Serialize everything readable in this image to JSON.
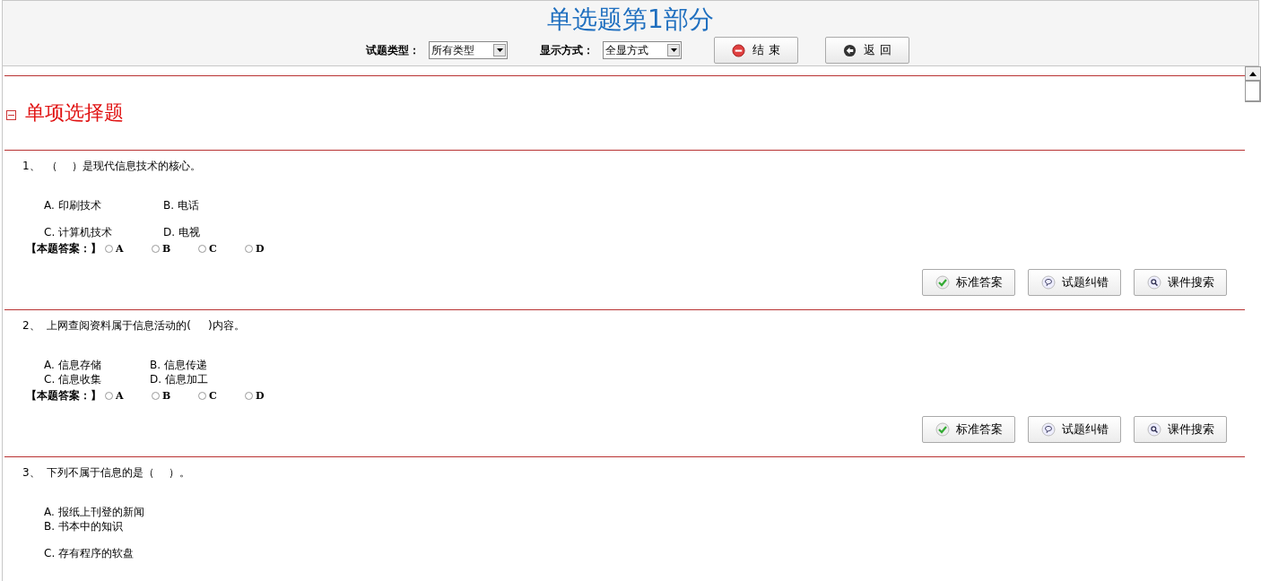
{
  "header": {
    "title": "单选题第1部分",
    "filters": [
      {
        "label": "试题类型：",
        "value": "所有类型"
      },
      {
        "label": "显示方式：",
        "value": "全显方式"
      }
    ],
    "buttons": [
      {
        "kind": "stop",
        "label": "结 束"
      },
      {
        "kind": "back",
        "label": "返 回"
      }
    ]
  },
  "section": {
    "title": "单项选择题",
    "expanded": true
  },
  "questions": [
    {
      "number": "1、",
      "text": "（    ）是现代信息技术的核心。",
      "option_groups": [
        {
          "rows": [
            [
              "A. 印刷技术",
              "B. 电话"
            ]
          ]
        },
        {
          "rows": [
            [
              "C. 计算机技术",
              "D. 电视"
            ]
          ]
        }
      ],
      "answer_label": "【本题答案：】",
      "choices": [
        {
          "label": "A",
          "selected": false
        },
        {
          "label": "B",
          "selected": false
        },
        {
          "label": "C",
          "selected": false
        },
        {
          "label": "D",
          "selected": false
        }
      ],
      "actions": [
        {
          "kind": "check",
          "label": "标准答案"
        },
        {
          "kind": "comment",
          "label": "试题纠错"
        },
        {
          "kind": "search",
          "label": "课件搜索"
        }
      ]
    },
    {
      "number": "2、",
      "text": "上网查阅资料属于信息活动的(     )内容。",
      "option_groups": [
        {
          "rows": [
            [
              "A. 信息存储",
              "B. 信息传递"
            ],
            [
              "C. 信息收集",
              "D. 信息加工"
            ]
          ]
        }
      ],
      "answer_label": "【本题答案：】",
      "choices": [
        {
          "label": "A",
          "selected": false
        },
        {
          "label": "B",
          "selected": false
        },
        {
          "label": "C",
          "selected": false
        },
        {
          "label": "D",
          "selected": false
        }
      ],
      "actions": [
        {
          "kind": "check",
          "label": "标准答案"
        },
        {
          "kind": "comment",
          "label": "试题纠错"
        },
        {
          "kind": "search",
          "label": "课件搜索"
        }
      ]
    },
    {
      "number": "3、",
      "text": "下列不属于信息的是（    ）。",
      "option_groups": [
        {
          "rows": [
            [
              "A. 报纸上刊登的新闻"
            ],
            [
              "B. 书本中的知识"
            ]
          ]
        },
        {
          "rows": [
            [
              "C. 存有程序的软盘"
            ]
          ]
        }
      ]
    }
  ]
}
